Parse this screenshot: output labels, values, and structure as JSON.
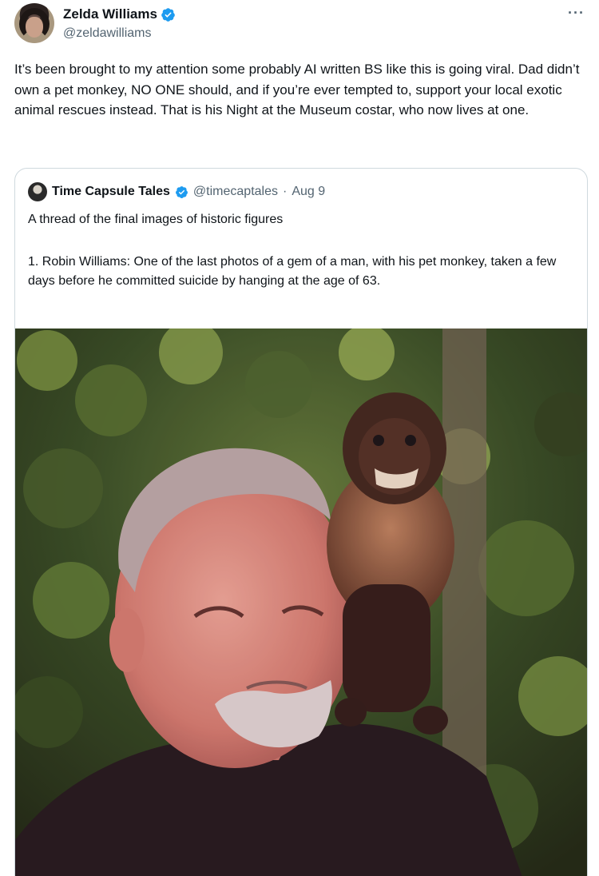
{
  "author": {
    "display_name": "Zelda Williams",
    "handle": "@zeldawilliams",
    "avatar_icon": "profile-avatar",
    "verified_icon": "verified-badge-icon",
    "more_icon": "more-options-icon"
  },
  "tweet": {
    "text": "It’s been brought to my attention some probably AI written BS like this is going viral. Dad didn’t own a pet monkey, NO ONE should, and if you’re ever tempted to, support your local exotic animal rescues instead. That is his Night at the Museum costar, who now lives at one."
  },
  "quoted": {
    "display_name": "Time Capsule Tales",
    "handle": "@timecaptales",
    "separator": "·",
    "date": "Aug 9",
    "line1": "A thread of the final images of historic figures",
    "line2": "1. Robin Williams: One of the last photos of a gem of a man, with his pet monkey, taken a few days before he committed suicide by hanging at the age of 63."
  },
  "colors": {
    "verified": "#1d9bf0",
    "text": "#0f1419",
    "secondary": "#536471",
    "border": "#cfd9de"
  }
}
